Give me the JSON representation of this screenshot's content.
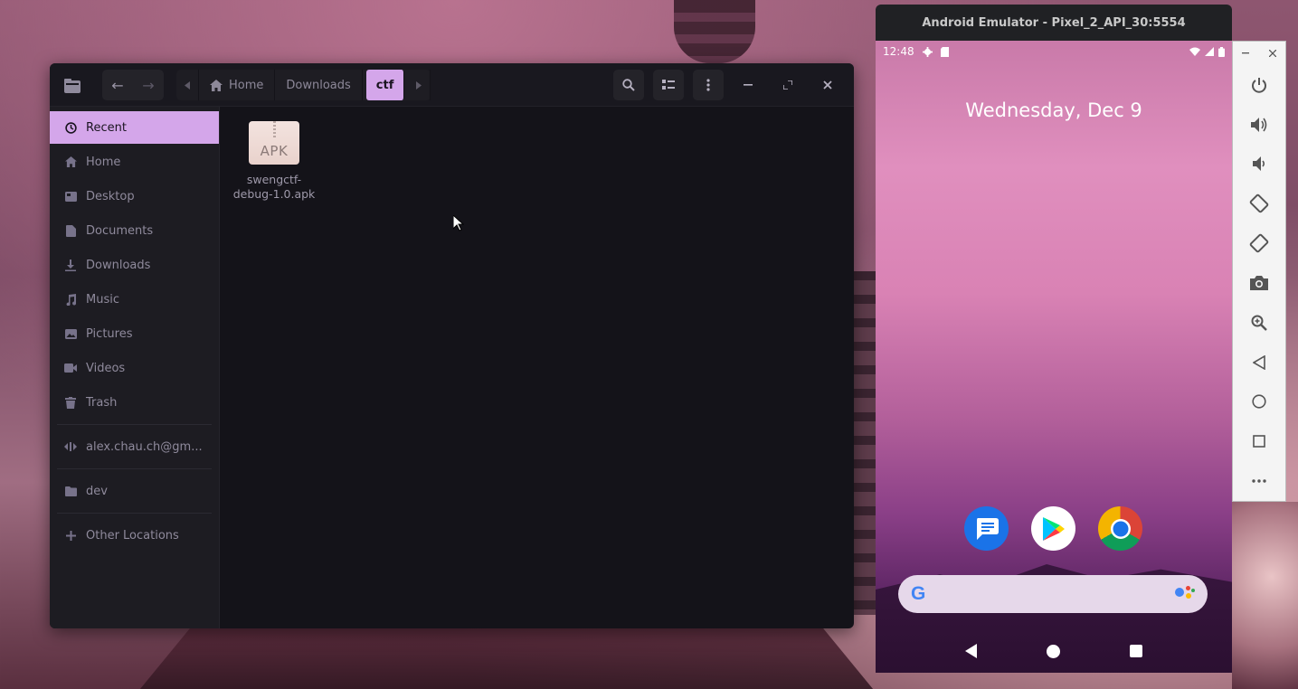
{
  "file_manager": {
    "nav": {
      "back": "←",
      "forward": "→"
    },
    "breadcrumbs": [
      {
        "label": "Home"
      },
      {
        "label": "Downloads"
      },
      {
        "label": "ctf"
      }
    ],
    "sidebar": {
      "places": [
        {
          "label": "Recent",
          "icon": "recent-icon"
        },
        {
          "label": "Home",
          "icon": "home-icon"
        },
        {
          "label": "Desktop",
          "icon": "desktop-icon"
        },
        {
          "label": "Documents",
          "icon": "documents-icon"
        },
        {
          "label": "Downloads",
          "icon": "downloads-icon"
        },
        {
          "label": "Music",
          "icon": "music-icon"
        },
        {
          "label": "Pictures",
          "icon": "pictures-icon"
        },
        {
          "label": "Videos",
          "icon": "videos-icon"
        },
        {
          "label": "Trash",
          "icon": "trash-icon"
        }
      ],
      "account": "alex.chau.ch@gm...",
      "bookmarks": [
        {
          "label": "dev",
          "icon": "folder-icon"
        }
      ],
      "other_locations": "Other Locations"
    },
    "files": [
      {
        "name_line1": "swengctf-",
        "name_line2": "debug-1.0.apk",
        "icon_label": "APK"
      }
    ],
    "accent_color": "#d4a6ea"
  },
  "emulator": {
    "title": "Android Emulator - Pixel_2_API_30:5554",
    "status_time": "12:48",
    "date": "Wednesday, Dec 9",
    "search_logo": "G",
    "toolbar": [
      "power-icon",
      "volume-up-icon",
      "volume-down-icon",
      "rotate-left-icon",
      "rotate-right-icon",
      "camera-icon",
      "zoom-icon",
      "back-icon",
      "home-icon",
      "overview-icon",
      "more-icon"
    ]
  }
}
